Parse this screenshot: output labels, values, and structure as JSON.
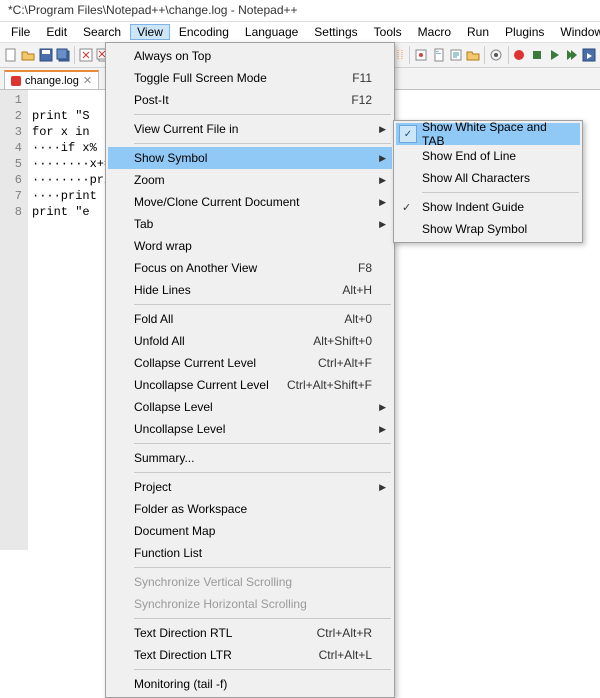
{
  "title": "*C:\\Program Files\\Notepad++\\change.log - Notepad++",
  "menubar": [
    "File",
    "Edit",
    "Search",
    "View",
    "Encoding",
    "Language",
    "Settings",
    "Tools",
    "Macro",
    "Run",
    "Plugins",
    "Window",
    "?"
  ],
  "active_menu": "View",
  "tab": {
    "name": "change.log"
  },
  "gutter_lines": [
    "1",
    "2",
    "3",
    "4",
    "5",
    "6",
    "7",
    "8"
  ],
  "code_lines": [
    "print \"S",
    "for x in",
    "····if x%",
    "········x+=",
    "········pri",
    "····print",
    "print \"e",
    ""
  ],
  "view_menu": {
    "always_on_top": "Always on Top",
    "full_screen": "Toggle Full Screen Mode",
    "full_screen_key": "F11",
    "post_it": "Post-It",
    "post_it_key": "F12",
    "view_curr_file": "View Current File in",
    "show_symbol": "Show Symbol",
    "zoom": "Zoom",
    "move_clone": "Move/Clone Current Document",
    "tab_sub": "Tab",
    "word_wrap": "Word wrap",
    "focus_other": "Focus on Another View",
    "focus_other_key": "F8",
    "hide_lines": "Hide Lines",
    "hide_lines_key": "Alt+H",
    "fold_all": "Fold All",
    "fold_all_key": "Alt+0",
    "unfold_all": "Unfold All",
    "unfold_all_key": "Alt+Shift+0",
    "collapse_cur": "Collapse Current Level",
    "collapse_cur_key": "Ctrl+Alt+F",
    "uncollapse_cur": "Uncollapse Current Level",
    "uncollapse_cur_key": "Ctrl+Alt+Shift+F",
    "collapse_lvl": "Collapse Level",
    "uncollapse_lvl": "Uncollapse Level",
    "summary": "Summary...",
    "project": "Project",
    "folder_ws": "Folder as Workspace",
    "doc_map": "Document Map",
    "func_list": "Function List",
    "sync_v": "Synchronize Vertical Scrolling",
    "sync_h": "Synchronize Horizontal Scrolling",
    "rtl": "Text Direction RTL",
    "rtl_key": "Ctrl+Alt+R",
    "ltr": "Text Direction LTR",
    "ltr_key": "Ctrl+Alt+L",
    "monitor": "Monitoring (tail -f)"
  },
  "symbol_submenu": {
    "ws_tab": "Show White Space and TAB",
    "eol": "Show End of Line",
    "all_chars": "Show All Characters",
    "indent_guide": "Show Indent Guide",
    "wrap_symbol": "Show Wrap Symbol"
  }
}
